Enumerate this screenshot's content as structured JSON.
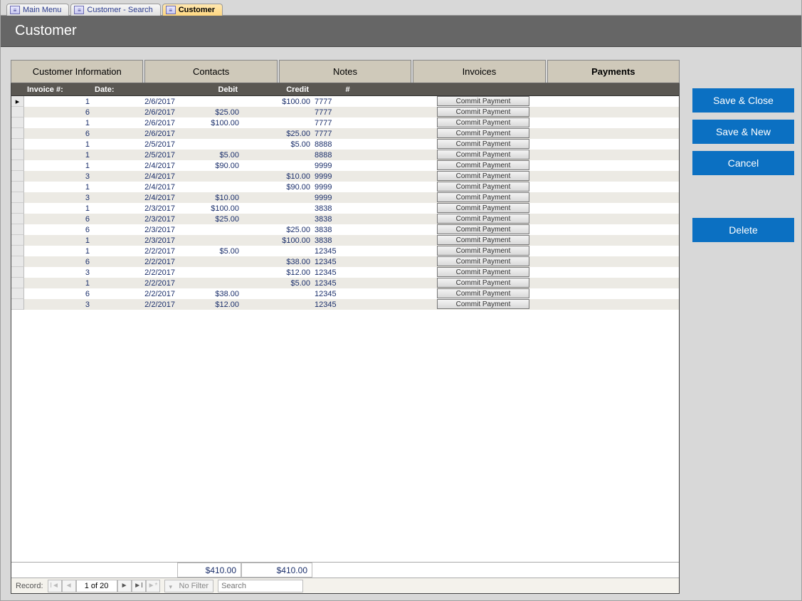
{
  "window_tabs": [
    {
      "label": "Main Menu",
      "active": false
    },
    {
      "label": "Customer - Search",
      "active": false
    },
    {
      "label": "Customer",
      "active": true
    }
  ],
  "form_title": "Customer",
  "sub_tabs": [
    {
      "label": "Customer Information",
      "active": false
    },
    {
      "label": "Contacts",
      "active": false
    },
    {
      "label": "Notes",
      "active": false
    },
    {
      "label": "Invoices",
      "active": false
    },
    {
      "label": "Payments",
      "active": true
    }
  ],
  "columns": {
    "invoice": "Invoice #:",
    "date": "Date:",
    "debit": "Debit",
    "credit": "Credit",
    "num": "#"
  },
  "commit_label": "Commit Payment",
  "rows": [
    {
      "inv": "1",
      "date": "2/6/2017",
      "debit": "",
      "credit": "$100.00",
      "num": "7777",
      "sel": true
    },
    {
      "inv": "6",
      "date": "2/6/2017",
      "debit": "$25.00",
      "credit": "",
      "num": "7777"
    },
    {
      "inv": "1",
      "date": "2/6/2017",
      "debit": "$100.00",
      "credit": "",
      "num": "7777"
    },
    {
      "inv": "6",
      "date": "2/6/2017",
      "debit": "",
      "credit": "$25.00",
      "num": "7777"
    },
    {
      "inv": "1",
      "date": "2/5/2017",
      "debit": "",
      "credit": "$5.00",
      "num": "8888"
    },
    {
      "inv": "1",
      "date": "2/5/2017",
      "debit": "$5.00",
      "credit": "",
      "num": "8888"
    },
    {
      "inv": "1",
      "date": "2/4/2017",
      "debit": "$90.00",
      "credit": "",
      "num": "9999"
    },
    {
      "inv": "3",
      "date": "2/4/2017",
      "debit": "",
      "credit": "$10.00",
      "num": "9999"
    },
    {
      "inv": "1",
      "date": "2/4/2017",
      "debit": "",
      "credit": "$90.00",
      "num": "9999"
    },
    {
      "inv": "3",
      "date": "2/4/2017",
      "debit": "$10.00",
      "credit": "",
      "num": "9999"
    },
    {
      "inv": "1",
      "date": "2/3/2017",
      "debit": "$100.00",
      "credit": "",
      "num": "3838"
    },
    {
      "inv": "6",
      "date": "2/3/2017",
      "debit": "$25.00",
      "credit": "",
      "num": "3838"
    },
    {
      "inv": "6",
      "date": "2/3/2017",
      "debit": "",
      "credit": "$25.00",
      "num": "3838"
    },
    {
      "inv": "1",
      "date": "2/3/2017",
      "debit": "",
      "credit": "$100.00",
      "num": "3838"
    },
    {
      "inv": "1",
      "date": "2/2/2017",
      "debit": "$5.00",
      "credit": "",
      "num": "12345"
    },
    {
      "inv": "6",
      "date": "2/2/2017",
      "debit": "",
      "credit": "$38.00",
      "num": "12345"
    },
    {
      "inv": "3",
      "date": "2/2/2017",
      "debit": "",
      "credit": "$12.00",
      "num": "12345"
    },
    {
      "inv": "1",
      "date": "2/2/2017",
      "debit": "",
      "credit": "$5.00",
      "num": "12345"
    },
    {
      "inv": "6",
      "date": "2/2/2017",
      "debit": "$38.00",
      "credit": "",
      "num": "12345"
    },
    {
      "inv": "3",
      "date": "2/2/2017",
      "debit": "$12.00",
      "credit": "",
      "num": "12345"
    }
  ],
  "totals": {
    "debit": "$410.00",
    "credit": "$410.00"
  },
  "record_nav": {
    "label": "Record:",
    "position": "1 of 20",
    "no_filter": "No Filter",
    "search_placeholder": "Search"
  },
  "actions": {
    "save_close": "Save & Close",
    "save_new": "Save & New",
    "cancel": "Cancel",
    "delete": "Delete"
  }
}
